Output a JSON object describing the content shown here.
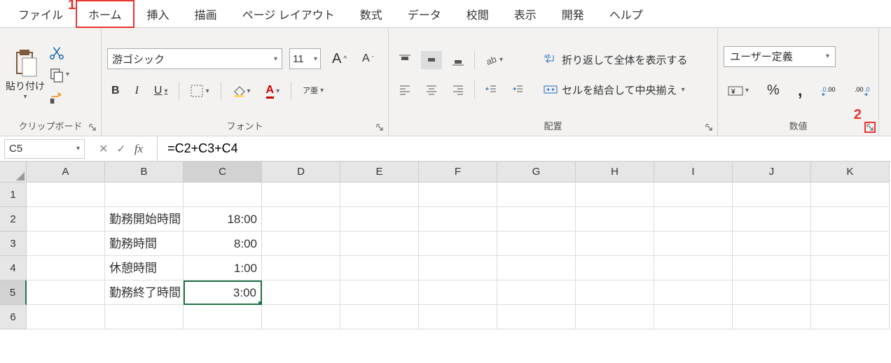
{
  "tabs": {
    "file": "ファイル",
    "home": "ホーム",
    "insert": "挿入",
    "draw": "描画",
    "page_layout": "ページ レイアウト",
    "formulas": "数式",
    "data": "データ",
    "review": "校閲",
    "view": "表示",
    "developer": "開発",
    "help": "ヘルプ"
  },
  "annotations": {
    "one": "1",
    "two": "2"
  },
  "ribbon": {
    "clipboard": {
      "label": "クリップボード",
      "paste": "貼り付け"
    },
    "font": {
      "label": "フォント",
      "name": "游ゴシック",
      "size": "11",
      "bold": "B",
      "italic": "I",
      "underline": "U",
      "increase": "A",
      "decrease": "A",
      "phonetic": "ア亜"
    },
    "alignment": {
      "label": "配置",
      "wrap": "折り返して全体を表示する",
      "merge": "セルを結合して中央揃え"
    },
    "number": {
      "label": "数値",
      "format": "ユーザー定義",
      "percent": "%",
      "comma": ","
    }
  },
  "formula_bar": {
    "name_box": "C5",
    "formula": "=C2+C3+C4"
  },
  "grid": {
    "cols": [
      "A",
      "B",
      "C",
      "D",
      "E",
      "F",
      "G",
      "H",
      "I",
      "J",
      "K"
    ],
    "rows": [
      "1",
      "2",
      "3",
      "4",
      "5",
      "6"
    ],
    "data": {
      "B2": "勤務開始時間",
      "C2": "18:00",
      "B3": "勤務時間",
      "C3": "8:00",
      "B4": "休憩時間",
      "C4": "1:00",
      "B5": "勤務終了時間",
      "C5": "3:00"
    },
    "active": "C5"
  }
}
